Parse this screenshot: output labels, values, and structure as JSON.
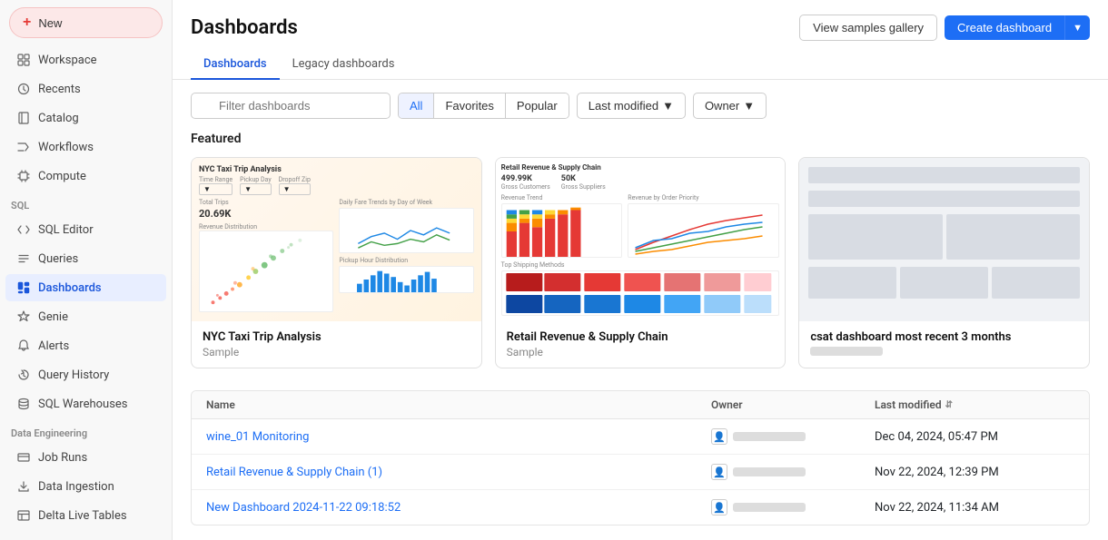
{
  "sidebar": {
    "new_label": "New",
    "items": [
      {
        "id": "workspace",
        "label": "Workspace",
        "icon": "grid"
      },
      {
        "id": "recents",
        "label": "Recents",
        "icon": "clock"
      },
      {
        "id": "catalog",
        "label": "Catalog",
        "icon": "book"
      },
      {
        "id": "workflows",
        "label": "Workflows",
        "icon": "shuffle"
      },
      {
        "id": "compute",
        "label": "Compute",
        "icon": "cpu"
      }
    ],
    "sql_section": "SQL",
    "sql_items": [
      {
        "id": "sql-editor",
        "label": "SQL Editor",
        "icon": "code"
      },
      {
        "id": "queries",
        "label": "Queries",
        "icon": "list"
      },
      {
        "id": "dashboards",
        "label": "Dashboards",
        "icon": "dashboard",
        "active": true
      },
      {
        "id": "genie",
        "label": "Genie",
        "icon": "star"
      },
      {
        "id": "alerts",
        "label": "Alerts",
        "icon": "bell"
      },
      {
        "id": "query-history",
        "label": "Query History",
        "icon": "history"
      },
      {
        "id": "sql-warehouses",
        "label": "SQL Warehouses",
        "icon": "database"
      }
    ],
    "data_engineering_section": "Data Engineering",
    "de_items": [
      {
        "id": "job-runs",
        "label": "Job Runs",
        "icon": "jobs"
      },
      {
        "id": "data-ingestion",
        "label": "Data Ingestion",
        "icon": "download"
      },
      {
        "id": "delta-live-tables",
        "label": "Delta Live Tables",
        "icon": "table"
      }
    ]
  },
  "main": {
    "title": "Dashboards",
    "view_samples_label": "View samples gallery",
    "create_dashboard_label": "Create dashboard",
    "tabs": [
      {
        "id": "dashboards",
        "label": "Dashboards",
        "active": true
      },
      {
        "id": "legacy",
        "label": "Legacy dashboards",
        "active": false
      }
    ],
    "filter": {
      "search_placeholder": "Filter dashboards",
      "all_label": "All",
      "favorites_label": "Favorites",
      "popular_label": "Popular",
      "last_modified_label": "Last modified",
      "owner_label": "Owner"
    },
    "featured": {
      "section_label": "Featured",
      "cards": [
        {
          "id": "nyc-taxi",
          "title": "NYC Taxi Trip Analysis",
          "subtitle": "Sample",
          "type": "nyc"
        },
        {
          "id": "retail-revenue",
          "title": "Retail Revenue & Supply Chain",
          "subtitle": "Sample",
          "type": "retail"
        },
        {
          "id": "csat",
          "title": "csat dashboard most recent 3 months",
          "subtitle": "",
          "type": "csat"
        }
      ]
    },
    "table": {
      "columns": [
        "Name",
        "Owner",
        "Last modified"
      ],
      "rows": [
        {
          "name": "wine_01 Monitoring",
          "owner_placeholder": true,
          "last_modified": "Dec 04, 2024, 05:47 PM"
        },
        {
          "name": "Retail Revenue & Supply Chain (1)",
          "owner_placeholder": true,
          "last_modified": "Nov 22, 2024, 12:39 PM"
        },
        {
          "name": "New Dashboard 2024-11-22 09:18:52",
          "owner_placeholder": true,
          "last_modified": "Nov 22, 2024, 11:34 AM"
        }
      ]
    }
  }
}
